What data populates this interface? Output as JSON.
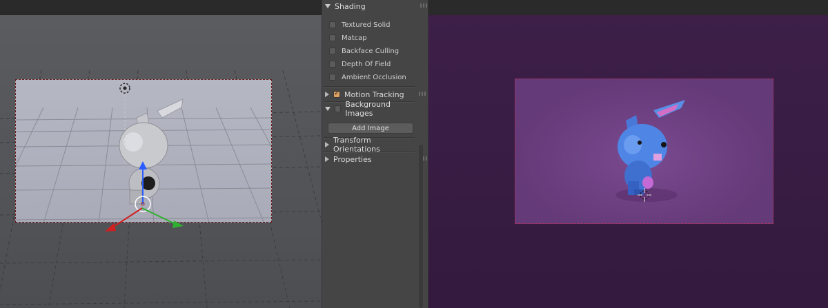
{
  "panel": {
    "shading": {
      "label": "Shading",
      "options": [
        {
          "label": "Textured Solid",
          "checked": false
        },
        {
          "label": "Matcap",
          "checked": false
        },
        {
          "label": "Backface Culling",
          "checked": false
        },
        {
          "label": "Depth Of Field",
          "checked": false
        },
        {
          "label": "Ambient Occlusion",
          "checked": false
        }
      ]
    },
    "motion_tracking": {
      "label": "Motion Tracking",
      "checked": true
    },
    "background_images": {
      "label": "Background Images",
      "checked": false,
      "button": "Add Image"
    },
    "transform_orientations": {
      "label": "Transform Orientations"
    },
    "properties": {
      "label": "Properties"
    }
  },
  "icons": [
    "triangle-down-icon",
    "triangle-right-icon",
    "checkbox-icon",
    "drag-grip-icon",
    "3d-cursor-icon",
    "transform-gizmo-icon"
  ],
  "colors": {
    "panel_bg": "#454545",
    "viewport_bg": "#555759",
    "render_bg": "#3b1e45",
    "render_frame_bg": "#6e3f83",
    "checkbox_active": "#e0a060",
    "gizmo_z": "#2a5cff",
    "gizmo_x": "#d02020",
    "gizmo_y": "#30b030"
  }
}
